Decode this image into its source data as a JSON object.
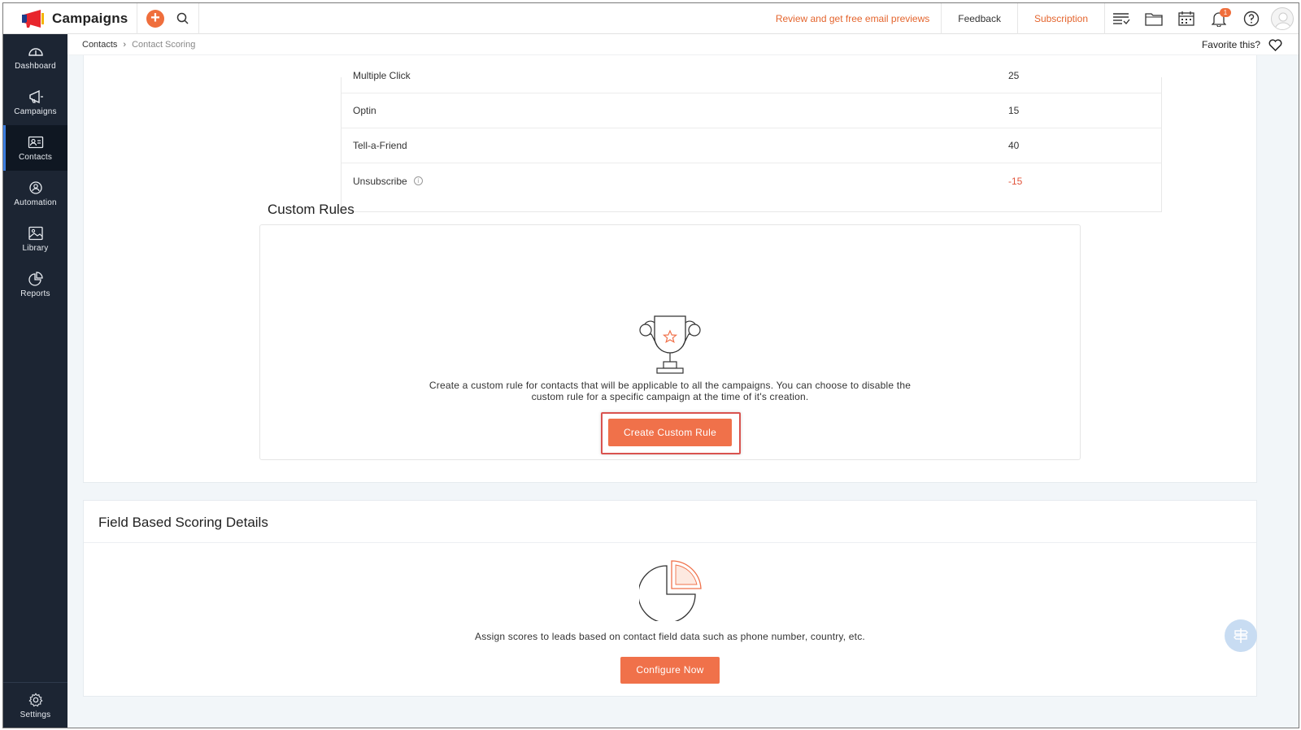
{
  "app": {
    "name": "Campaigns"
  },
  "topbar": {
    "review_link": "Review and get free email previews",
    "feedback": "Feedback",
    "subscription": "Subscription",
    "notification_count": "1",
    "icons": [
      "add-icon",
      "search-icon",
      "list-icon",
      "folder-icon",
      "calendar-icon",
      "bell-icon",
      "help-icon",
      "avatar"
    ]
  },
  "sidebar": {
    "items": [
      {
        "label": "Dashboard",
        "icon": "dashboard-icon"
      },
      {
        "label": "Campaigns",
        "icon": "megaphone-icon"
      },
      {
        "label": "Contacts",
        "icon": "contact-card-icon",
        "active": true
      },
      {
        "label": "Automation",
        "icon": "automation-icon"
      },
      {
        "label": "Library",
        "icon": "image-icon"
      },
      {
        "label": "Reports",
        "icon": "pie-chart-icon"
      }
    ],
    "settings": {
      "label": "Settings",
      "icon": "gear-icon"
    }
  },
  "breadcrumb": {
    "parent": "Contacts",
    "current": "Contact Scoring"
  },
  "favorite": {
    "label": "Favorite this?"
  },
  "scoring_rows": [
    {
      "label": "Multiple Click",
      "value": "25"
    },
    {
      "label": "Optin",
      "value": "15"
    },
    {
      "label": "Tell-a-Friend",
      "value": "40"
    },
    {
      "label": "Unsubscribe",
      "value": "-15"
    }
  ],
  "custom_rules": {
    "title": "Custom Rules",
    "description_line1": "Create a custom rule for contacts that will be applicable to all the campaigns. You can choose to disable the",
    "description_line2": "custom rule for a specific campaign at the time of it's creation.",
    "button": "Create Custom Rule"
  },
  "field_scoring": {
    "title": "Field Based Scoring Details",
    "description": "Assign scores to leads based on contact field data such as phone number, country, etc.",
    "button": "Configure Now"
  },
  "colors": {
    "accent": "#f0714a",
    "sidebar": "#1c2533",
    "negative": "#e2543b"
  }
}
